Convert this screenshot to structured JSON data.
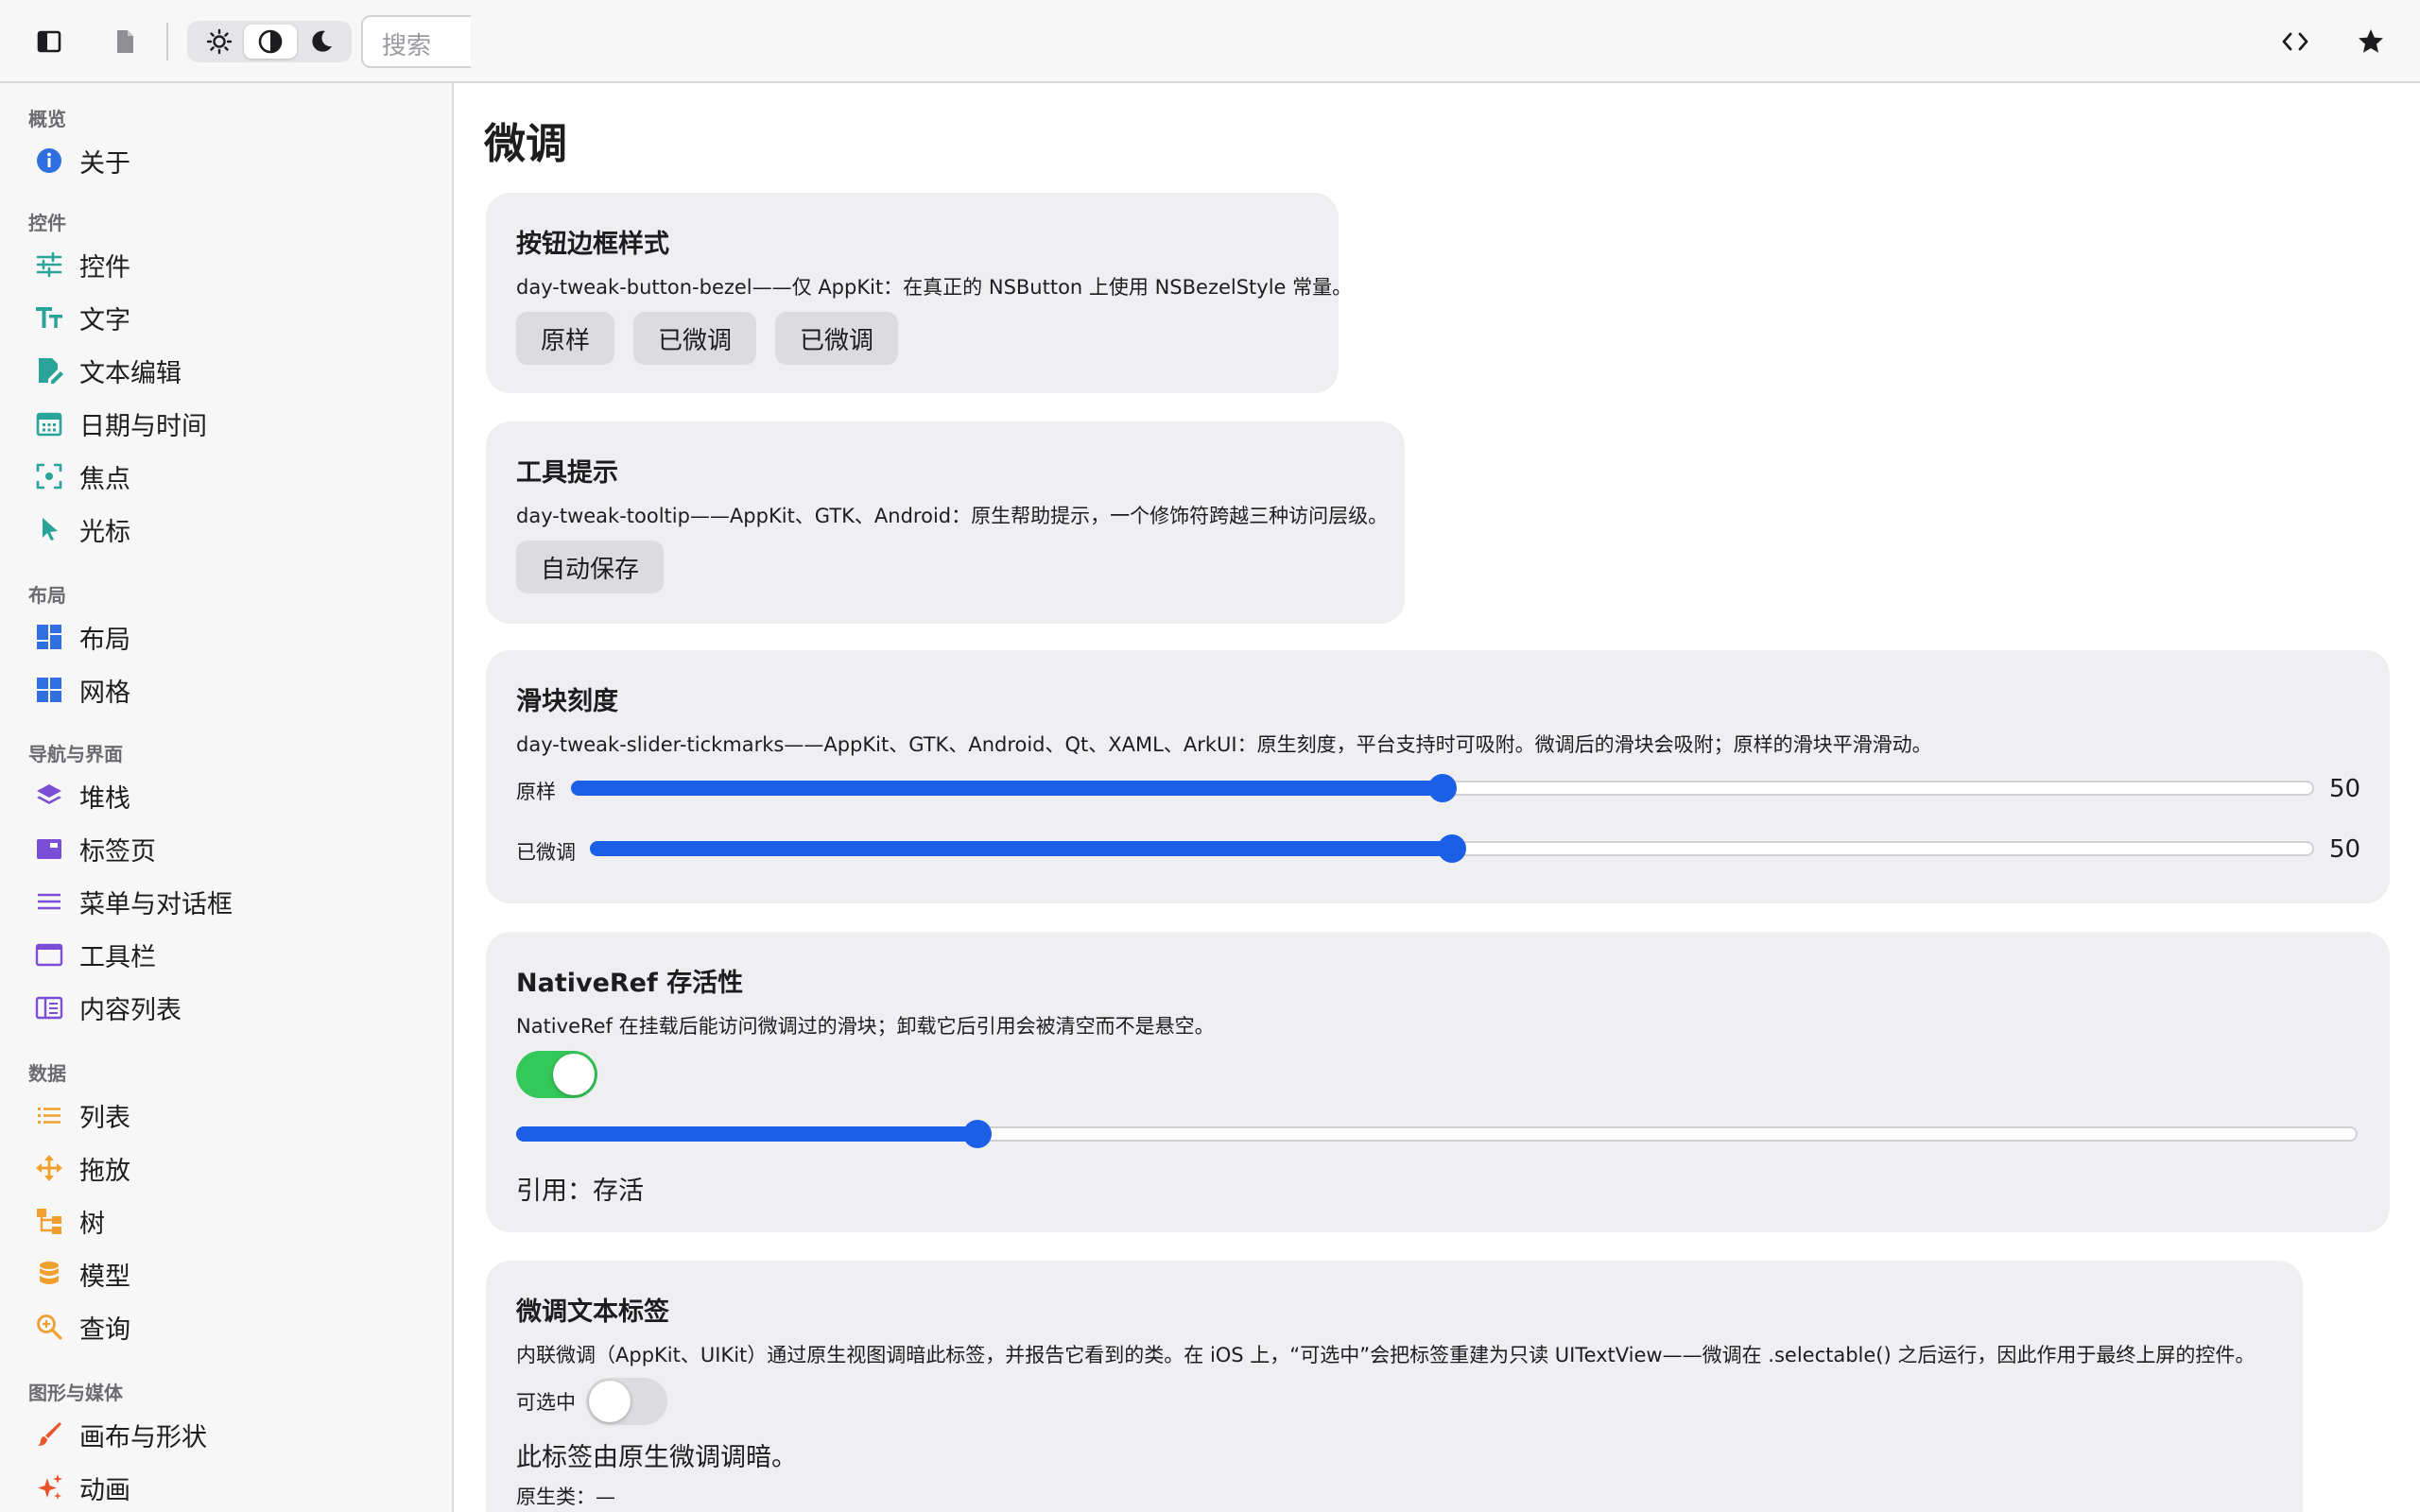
{
  "toolbar": {
    "search_placeholder": "搜索",
    "theme_options": [
      "light-icon",
      "auto-icon",
      "dark-icon"
    ],
    "theme_selected": "auto"
  },
  "sidebar": {
    "sections": [
      {
        "label": "概览",
        "items": [
          {
            "label": "关于",
            "icon": "info-icon",
            "color": "#2f6fe0"
          }
        ]
      },
      {
        "label": "控件",
        "items": [
          {
            "label": "控件",
            "icon": "sliders-icon",
            "color": "#2aa39a"
          },
          {
            "label": "文字",
            "icon": "text-size-icon",
            "color": "#2aa39a"
          },
          {
            "label": "文本编辑",
            "icon": "edit-document-icon",
            "color": "#2aa39a"
          },
          {
            "label": "日期与时间",
            "icon": "calendar-icon",
            "color": "#2aa39a"
          },
          {
            "label": "焦点",
            "icon": "focus-icon",
            "color": "#2aa39a"
          },
          {
            "label": "光标",
            "icon": "cursor-icon",
            "color": "#2aa39a"
          }
        ]
      },
      {
        "label": "布局",
        "items": [
          {
            "label": "布局",
            "icon": "layout-icon",
            "color": "#2f6fe0"
          },
          {
            "label": "网格",
            "icon": "grid-icon",
            "color": "#2f6fe0"
          }
        ]
      },
      {
        "label": "导航与界面",
        "items": [
          {
            "label": "堆栈",
            "icon": "layers-icon",
            "color": "#7a4fd6"
          },
          {
            "label": "标签页",
            "icon": "tabs-icon",
            "color": "#7a4fd6"
          },
          {
            "label": "菜单与对话框",
            "icon": "menu-icon",
            "color": "#7a4fd6"
          },
          {
            "label": "工具栏",
            "icon": "window-icon",
            "color": "#7a4fd6"
          },
          {
            "label": "内容列表",
            "icon": "columns-icon",
            "color": "#7a4fd6"
          }
        ]
      },
      {
        "label": "数据",
        "items": [
          {
            "label": "列表",
            "icon": "list-icon",
            "color": "#f0a030"
          },
          {
            "label": "拖放",
            "icon": "move-icon",
            "color": "#f0a030"
          },
          {
            "label": "树",
            "icon": "tree-icon",
            "color": "#f0a030"
          },
          {
            "label": "模型",
            "icon": "database-icon",
            "color": "#f0a030"
          },
          {
            "label": "查询",
            "icon": "search-zoom-icon",
            "color": "#f0a030"
          }
        ]
      },
      {
        "label": "图形与媒体",
        "items": [
          {
            "label": "画布与形状",
            "icon": "brush-icon",
            "color": "#e8552c"
          },
          {
            "label": "动画",
            "icon": "sparkle-icon",
            "color": "#e8552c"
          }
        ]
      }
    ]
  },
  "main": {
    "title": "微调",
    "bezel_card": {
      "title": "按钮边框样式",
      "desc": "day-tweak-button-bezel——仅 AppKit：在真正的 NSButton 上使用 NSBezelStyle 常量。",
      "buttons": [
        "原样",
        "已微调",
        "已微调"
      ]
    },
    "tooltip_card": {
      "title": "工具提示",
      "desc": "day-tweak-tooltip——AppKit、GTK、Android：原生帮助提示，一个修饰符跨越三种访问层级。",
      "button": "自动保存"
    },
    "slider_card": {
      "title": "滑块刻度",
      "desc": "day-tweak-slider-tickmarks——AppKit、GTK、Android、Qt、XAML、ArkUI：原生刻度，平台支持时可吸附。微调后的滑块会吸附；原样的滑块平滑滑动。",
      "rows": [
        {
          "label": "原样",
          "value": "50",
          "fraction": 0.5
        },
        {
          "label": "已微调",
          "value": "50",
          "fraction": 0.5
        }
      ]
    },
    "nativeref_card": {
      "title": "NativeRef 存活性",
      "desc": "NativeRef 在挂载后能访问微调过的滑块；卸载它后引用会被清空而不是悬空。",
      "toggle_on": true,
      "slider_fraction": 0.25,
      "status": "引用：存活",
      "accent": "#34c759"
    },
    "label_card": {
      "title": "微调文本标签",
      "desc": "内联微调（AppKit、UIKit）通过原生视图调暗此标签，并报告它看到的类。在 iOS 上，“可选中”会把标签重建为只读 UITextView——微调在 .selectable() 之后运行，因此作用于最终上屏的控件。",
      "toggle_label": "可选中",
      "toggle_on": false,
      "dimmed_text": "此标签由原生微调调暗。",
      "native_class": "原生类：—"
    }
  }
}
